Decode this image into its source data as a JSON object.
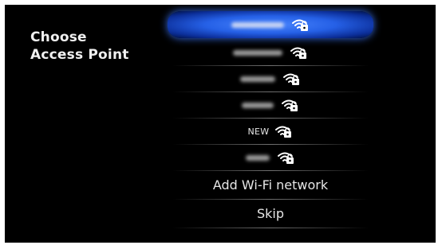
{
  "page": {
    "title_line1": "Choose",
    "title_line2": "Access Point"
  },
  "colors": {
    "background": "#000000",
    "selected_highlight": "#2a63ea",
    "text": "#e8e8e8"
  },
  "networks": [
    {
      "ssid_visible": false,
      "secured": true,
      "selected": true,
      "icon": "wifi-lock-icon"
    },
    {
      "ssid_visible": false,
      "secured": true,
      "selected": false,
      "icon": "wifi-lock-icon"
    },
    {
      "ssid_visible": false,
      "secured": true,
      "selected": false,
      "icon": "wifi-lock-icon"
    },
    {
      "ssid_visible": false,
      "secured": true,
      "selected": false,
      "icon": "wifi-lock-icon"
    },
    {
      "ssid": "NEW",
      "ssid_visible": true,
      "secured": true,
      "selected": false,
      "icon": "wifi-lock-icon"
    },
    {
      "ssid_visible": false,
      "secured": true,
      "selected": false,
      "icon": "wifi-lock-icon"
    }
  ],
  "actions": {
    "add_network_label": "Add Wi-Fi network",
    "skip_label": "Skip"
  }
}
